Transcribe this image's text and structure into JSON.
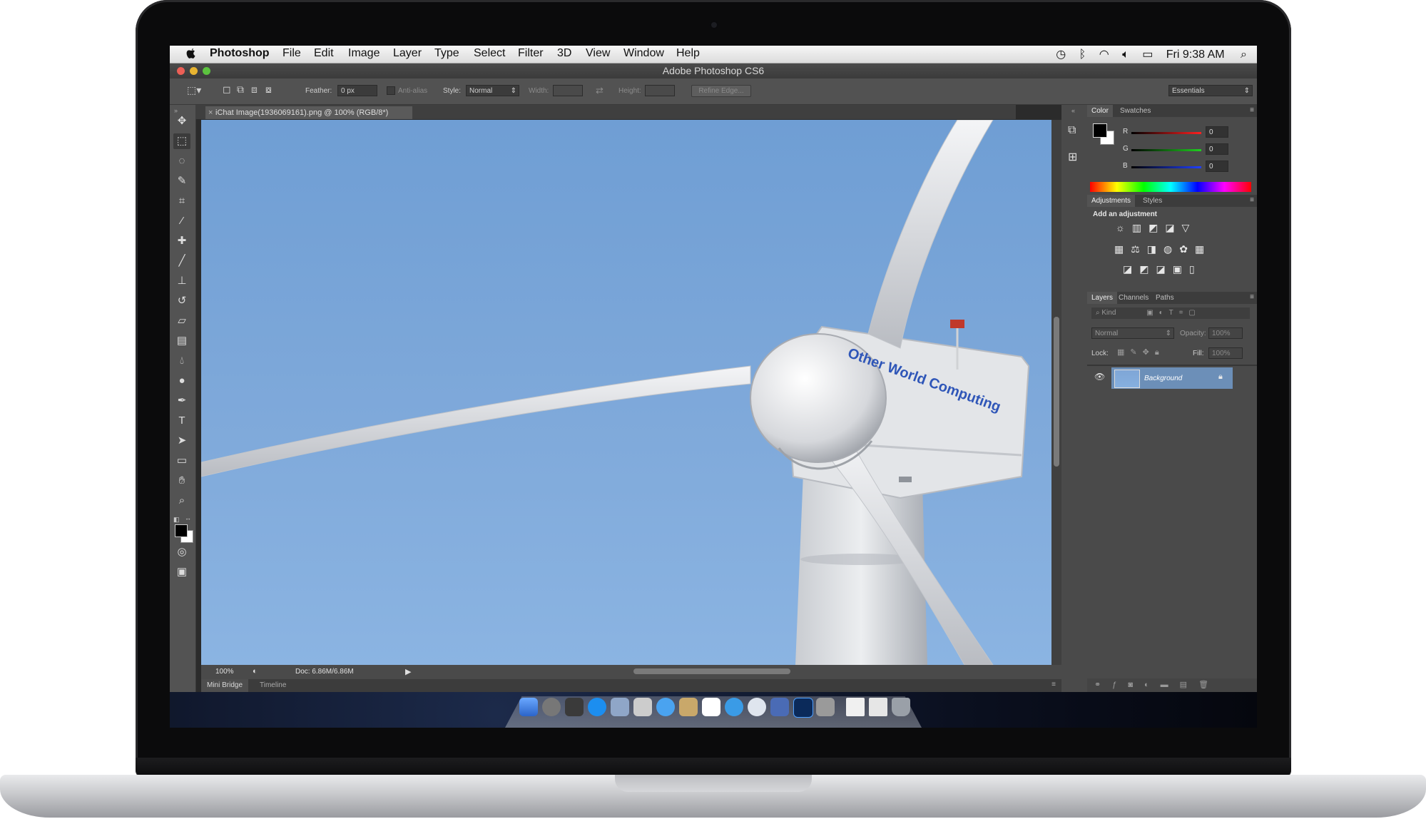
{
  "menubar": {
    "app_name": "Photoshop",
    "items": [
      "File",
      "Edit",
      "Image",
      "Layer",
      "Type",
      "Select",
      "Filter",
      "3D",
      "View",
      "Window",
      "Help"
    ],
    "clock": "Fri 9:38 AM"
  },
  "window": {
    "title": "Adobe Photoshop CS6"
  },
  "options": {
    "feather_label": "Feather:",
    "feather_value": "0 px",
    "antialias_label": "Anti-alias",
    "style_label": "Style:",
    "style_value": "Normal",
    "width_label": "Width:",
    "height_label": "Height:",
    "refine_label": "Refine Edge...",
    "workspace": "Essentials"
  },
  "document": {
    "tab_title": "iChat Image(1936069161).png @ 100% (RGB/8*)",
    "zoom": "100%",
    "doc_size": "Doc: 6.86M/6.86M",
    "watermark": "Other World Computing"
  },
  "bottom_tabs": [
    "Mini Bridge",
    "Timeline"
  ],
  "color_panel": {
    "tabs": [
      "Color",
      "Swatches"
    ],
    "channels": [
      {
        "label": "R",
        "value": "0",
        "color": "#ff2020"
      },
      {
        "label": "G",
        "value": "0",
        "color": "#20d020"
      },
      {
        "label": "B",
        "value": "0",
        "color": "#2040ff"
      }
    ]
  },
  "adjustments_panel": {
    "tabs": [
      "Adjustments",
      "Styles"
    ],
    "heading": "Add an adjustment"
  },
  "layers_panel": {
    "tabs": [
      "Layers",
      "Channels",
      "Paths"
    ],
    "kind_label": "Kind",
    "blend_mode": "Normal",
    "opacity_label": "Opacity:",
    "opacity_value": "100%",
    "lock_label": "Lock:",
    "fill_label": "Fill:",
    "fill_value": "100%",
    "layer_name": "Background"
  },
  "colors": {
    "accent_selected_layer": "#6c8fb8",
    "panel_bg": "#4a4a4a"
  }
}
